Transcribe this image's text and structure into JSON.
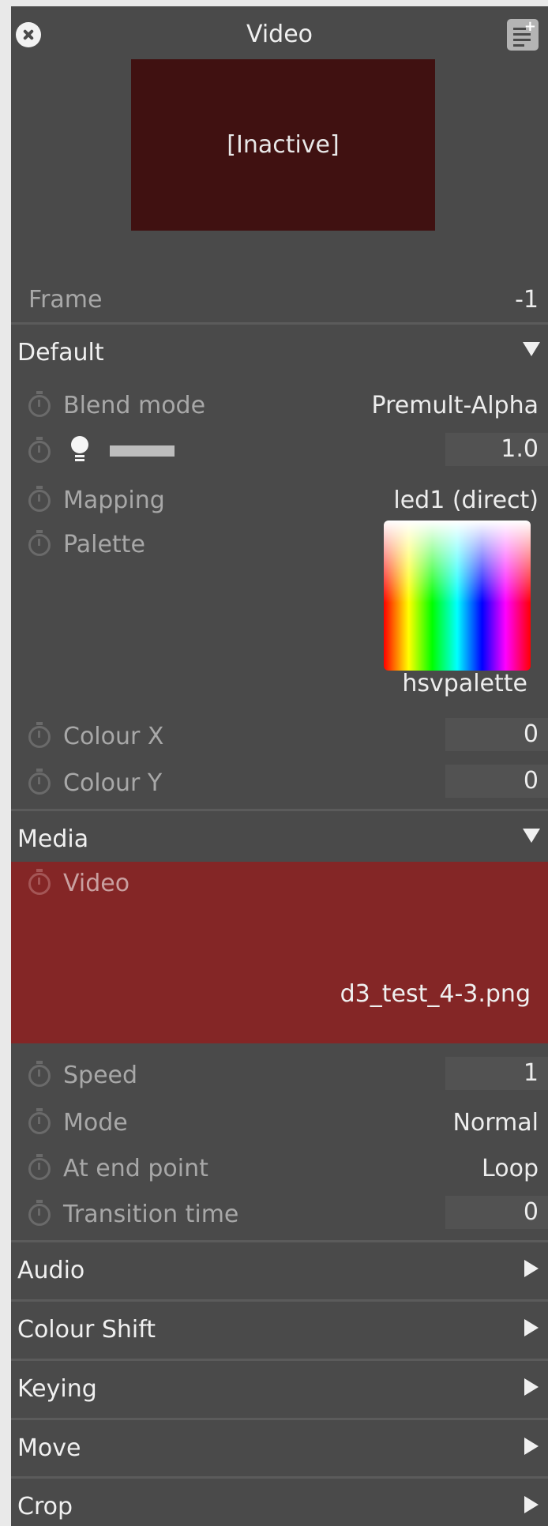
{
  "header": {
    "title": "Video",
    "preview_text": "[Inactive]"
  },
  "frame": {
    "label": "Frame",
    "value": "-1"
  },
  "default_section": {
    "title": "Default",
    "blend_mode": {
      "label": "Blend mode",
      "value": "Premult-Alpha"
    },
    "brightness": {
      "value": "1.0"
    },
    "mapping": {
      "label": "Mapping",
      "value": "led1 (direct)"
    },
    "palette": {
      "label": "Palette",
      "value": "hsvpalette"
    },
    "colour_x": {
      "label": "Colour X",
      "value": "0"
    },
    "colour_y": {
      "label": "Colour Y",
      "value": "0"
    }
  },
  "media_section": {
    "title": "Media",
    "video": {
      "label": "Video",
      "value": "d3_test_4-3.png"
    },
    "speed": {
      "label": "Speed",
      "value": "1"
    },
    "mode": {
      "label": "Mode",
      "value": "Normal"
    },
    "at_end_point": {
      "label": "At end point",
      "value": "Loop"
    },
    "transition_time": {
      "label": "Transition time",
      "value": "0"
    }
  },
  "collapsed_sections": [
    "Audio",
    "Colour Shift",
    "Keying",
    "Move",
    "Crop"
  ],
  "colors": {
    "panel": "#4a4a4a",
    "preview": "#401111",
    "video_highlight": "#842626"
  }
}
